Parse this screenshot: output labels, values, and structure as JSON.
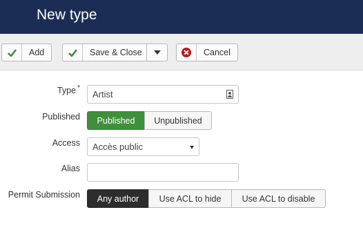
{
  "header": {
    "title": "New type"
  },
  "toolbar": {
    "add_label": "Add",
    "save_close_label": "Save & Close",
    "cancel_label": "Cancel"
  },
  "form": {
    "type": {
      "label": "Type",
      "required_mark": "*",
      "value": "Artist"
    },
    "published": {
      "label": "Published",
      "options": [
        "Published",
        "Unpublished"
      ],
      "selected": "Published"
    },
    "access": {
      "label": "Access",
      "value": "Accès public"
    },
    "alias": {
      "label": "Alias",
      "value": ""
    },
    "permit_submission": {
      "label": "Permit Submission",
      "options": [
        "Any author",
        "Use ACL to hide",
        "Use ACL to disable"
      ],
      "selected": "Any author"
    }
  },
  "colors": {
    "header_bg": "#1c2d55",
    "check_green": "#3f8f3c",
    "cancel_red": "#b91c1c",
    "published_active": "#3f8f3c",
    "permit_active": "#2d2d2d"
  },
  "icons": {
    "add": "check-icon",
    "save_close": "check-icon",
    "dropdown": "caret-down-icon",
    "cancel": "cancel-icon",
    "type_field": "contact-card-icon",
    "access_select": "select-arrow-icon"
  }
}
